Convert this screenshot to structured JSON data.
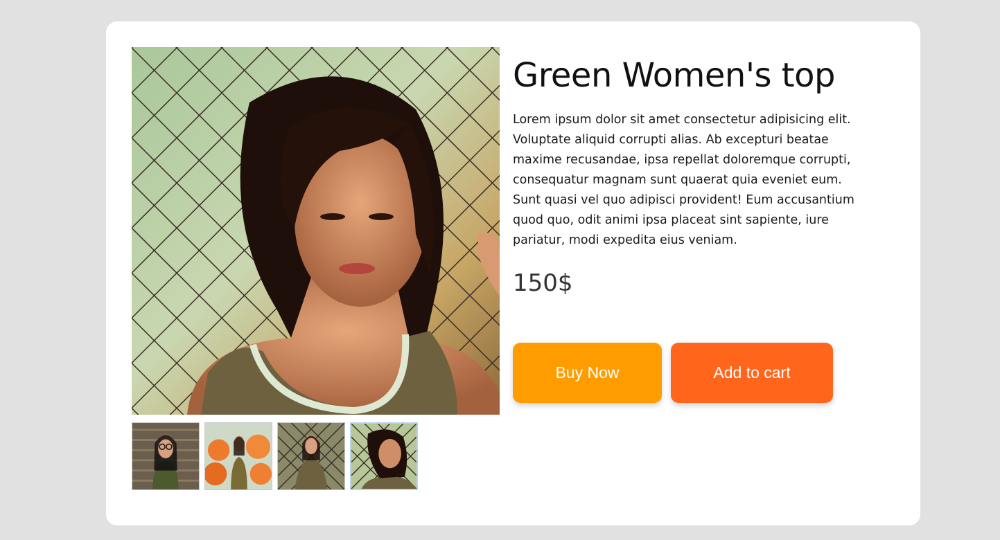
{
  "product": {
    "title": "Green Women's top",
    "description": "Lorem ipsum dolor sit amet consectetur adipisicing elit. Voluptate aliquid corrupti alias. Ab excepturi beatae maxime recusandae, ipsa repellat doloremque corrupti, consequatur magnam sunt quaerat quia eveniet eum. Sunt quasi vel quo adipisci provident! Eum accusantium quod quo, odit animi ipsa placeat sint sapiente, iure pariatur, modi expedita eius veniam.",
    "price": "150$"
  },
  "actions": {
    "buy_label": "Buy Now",
    "cart_label": "Add to cart"
  },
  "gallery": {
    "selected_index": 3,
    "thumbnail_count": 4
  },
  "colors": {
    "page_background": "#e1e1e1",
    "card_background": "#ffffff",
    "buy_button": "#ff9c00",
    "cart_button": "#ff661c",
    "active_thumb_border": "#b9d3ee"
  }
}
